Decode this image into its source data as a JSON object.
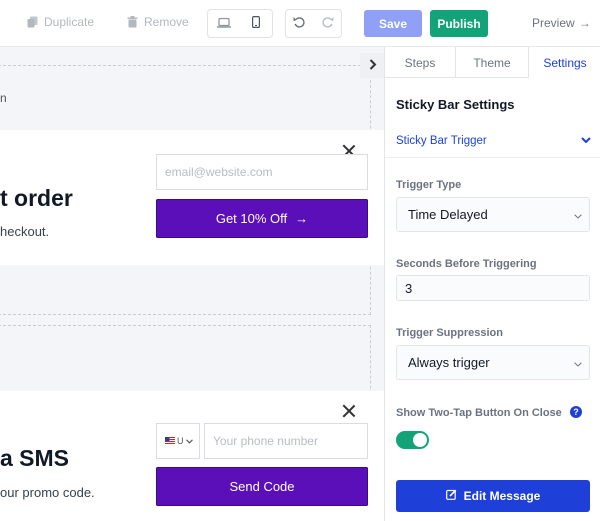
{
  "toolbar": {
    "duplicate_label": "Duplicate",
    "remove_label": "Remove",
    "save_label": "Save",
    "publish_label": "Publish",
    "preview_label": "Preview",
    "preview_arrow": "→",
    "colors": {
      "save": "#8fa0f6",
      "publish": "#13a378"
    }
  },
  "canvas": {
    "top_partial_text": "n",
    "email_card": {
      "headline": "t order",
      "subline": "heckout.",
      "email_placeholder": "email@website.com",
      "cta_label": "Get 10% Off",
      "cta_arrow": "→"
    },
    "sms_card": {
      "headline": "a SMS",
      "subline": "our promo code.",
      "country_code": "U",
      "phone_placeholder": "Your phone number",
      "cta_label": "Send Code"
    },
    "cta_color": "#5b0fb8"
  },
  "panel": {
    "tabs": [
      {
        "label": "Steps",
        "active": false
      },
      {
        "label": "Theme",
        "active": false
      },
      {
        "label": "Settings",
        "active": true
      }
    ],
    "title": "Sticky Bar Settings",
    "section_header": "Sticky Bar Trigger",
    "trigger_type": {
      "label": "Trigger Type",
      "value": "Time Delayed"
    },
    "seconds": {
      "label": "Seconds Before Triggering",
      "value": "3"
    },
    "suppression": {
      "label": "Trigger Suppression",
      "value": "Always trigger"
    },
    "two_tap": {
      "label": "Show Two-Tap Button On Close",
      "help": "?",
      "enabled": true
    },
    "edit_button_label": "Edit Message",
    "accent_color": "#1e40d8"
  }
}
